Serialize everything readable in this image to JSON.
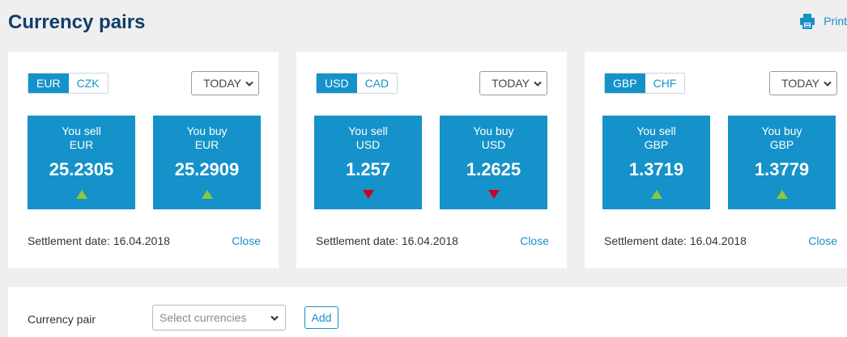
{
  "header": {
    "title": "Currency pairs",
    "print_label": "Print",
    "print_icon": "printer-icon"
  },
  "colors": {
    "accent": "#1592c9",
    "title": "#123d6b",
    "trend_up": "#8ec63f",
    "trend_down": "#d0021b"
  },
  "pairs": [
    {
      "base": "EUR",
      "quote": "CZK",
      "active": "base",
      "period": "TODAY",
      "sell": {
        "label": "You sell",
        "currency": "EUR",
        "value": "25.2305",
        "trend": "up"
      },
      "buy": {
        "label": "You buy",
        "currency": "EUR",
        "value": "25.2909",
        "trend": "up"
      },
      "settlement": "Settlement date: 16.04.2018",
      "close_label": "Close"
    },
    {
      "base": "USD",
      "quote": "CAD",
      "active": "base",
      "period": "TODAY",
      "sell": {
        "label": "You sell",
        "currency": "USD",
        "value": "1.257",
        "trend": "down"
      },
      "buy": {
        "label": "You buy",
        "currency": "USD",
        "value": "1.2625",
        "trend": "down"
      },
      "settlement": "Settlement date: 16.04.2018",
      "close_label": "Close"
    },
    {
      "base": "GBP",
      "quote": "CHF",
      "active": "base",
      "period": "TODAY",
      "sell": {
        "label": "You sell",
        "currency": "GBP",
        "value": "1.3719",
        "trend": "up"
      },
      "buy": {
        "label": "You buy",
        "currency": "GBP",
        "value": "1.3779",
        "trend": "up"
      },
      "settlement": "Settlement date: 16.04.2018",
      "close_label": "Close"
    }
  ],
  "add_pair": {
    "label": "Currency pair",
    "select_placeholder": "Select currencies",
    "add_label": "Add"
  }
}
